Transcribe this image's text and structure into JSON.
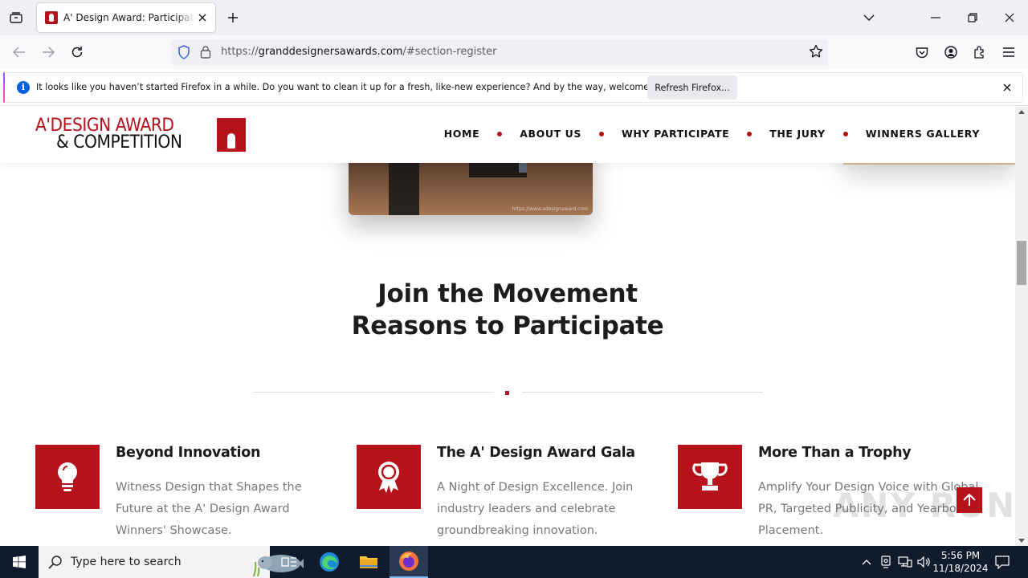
{
  "browser": {
    "tab_title": "A' Design Award: Participate for",
    "url_prefix": "https://",
    "url_host": "granddesignersawards.com",
    "url_path": "/#section-register",
    "notification": {
      "text": "It looks like you haven’t started Firefox in a while. Do you want to clean it up for a fresh, like-new experience? And by the way, welcome back!",
      "button_label": "Refresh Firefox..."
    }
  },
  "site": {
    "logo_line1": "A'DESIGN AWARD",
    "logo_line2": "& COMPETITION",
    "nav": [
      {
        "label": "HOME"
      },
      {
        "label": "ABOUT US"
      },
      {
        "label": "WHY PARTICIPATE"
      },
      {
        "label": "THE JURY"
      },
      {
        "label": "WINNERS GALLERY"
      }
    ],
    "photo_watermark": "https://www.adesignaward.com",
    "section_title_line1": "Join the Movement",
    "section_title_line2": "Reasons to Participate",
    "features": [
      {
        "icon": "lightbulb-icon",
        "title": "Beyond Innovation",
        "description": "Witness Design that Shapes the Future at the A' Design Award Winners' Showcase."
      },
      {
        "icon": "award-ribbon-icon",
        "title": "The A' Design Award Gala",
        "description": "A Night of Design Excellence. Join industry leaders and celebrate groundbreaking innovation."
      },
      {
        "icon": "trophy-icon",
        "title": "More Than a Trophy",
        "description": "Amplify Your Design Voice with Global PR, Targeted Publicity, and Yearbook Placement."
      }
    ],
    "watermark": "ANY RUN",
    "accent_color": "#b5121b"
  },
  "taskbar": {
    "search_placeholder": "Type here to search",
    "time": "5:56 PM",
    "date": "11/18/2024"
  }
}
